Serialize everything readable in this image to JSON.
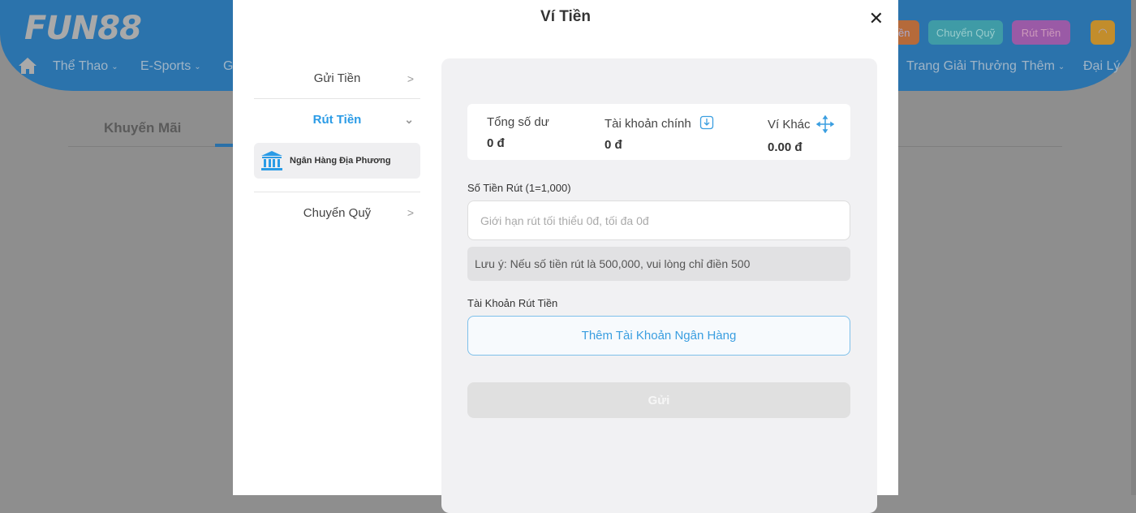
{
  "site": {
    "logo": "FUN88",
    "nav": [
      "Thể Thao",
      "E-Sports",
      "G",
      "Trang Giải Thưởng",
      "Thêm",
      "Đại Lý"
    ],
    "buttons": {
      "deposit": "Gửi Tiền",
      "transfer": "Chuyển Quỹ",
      "withdraw": "Rút Tiền"
    },
    "tab": "Khuyến Mãi"
  },
  "modal": {
    "title": "Ví Tiền",
    "sidebar": {
      "deposit": "Gửi Tiền",
      "withdraw": "Rút Tiền",
      "local_bank": "Ngân Hàng Địa Phương",
      "transfer": "Chuyển Quỹ"
    },
    "balance": {
      "total_label": "Tổng số dư",
      "total": "0 đ",
      "main_label": "Tài khoản chính",
      "main": "0 đ",
      "other_label": "Ví Khác",
      "other": "0.00 đ"
    },
    "amount_label": "Số Tiền Rút (1=1,000)",
    "amount_placeholder": "Giới hạn rút tối thiểu 0đ, tối đa 0đ",
    "note": "Lưu ý: Nếu số tiền rút là 500,000, vui lòng chỉ điền 500",
    "account_label": "Tài Khoản Rút Tiền",
    "add_bank": "Thêm Tài Khoản Ngân Hàng",
    "submit": "Gửi"
  }
}
